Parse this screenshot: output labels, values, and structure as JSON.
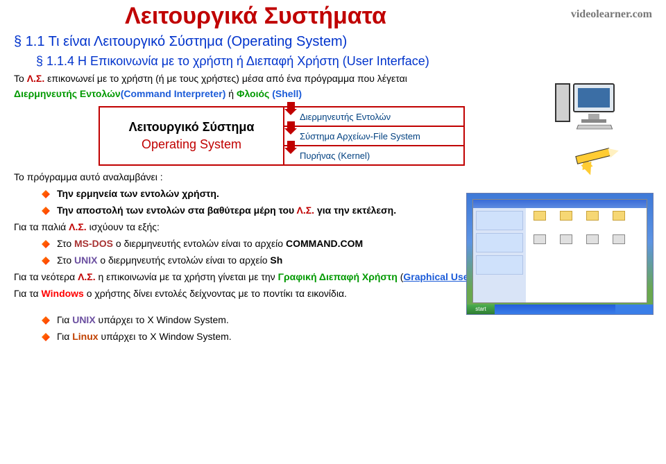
{
  "watermark": "videolearner.com",
  "title": "Λειτουργικά Συστήματα",
  "section": "1.1 Τι είναι Λειτουργικό Σύστημα (Operating System)",
  "subsection": "1.1.4 Η Επικοινωνία με το χρήστη ή Διεπαφή Χρήστη (User Interface)",
  "intro": {
    "pre": "Το ",
    "ls": "Λ.Σ.",
    "mid": " επικονωνεί με το χρήστη (ή με τους χρήστες) μέσα από ένα πρόγραμμα που λέγεται",
    "term1": "Διερμηνευτής Εντολών",
    "term1b": "(Command Interpreter)",
    "or": " ή ",
    "term2": "Φλοιός",
    "term2b": "(Shell)"
  },
  "osbox": {
    "line1": "Λειτουργικό Σύστημα",
    "line2": "Operating System",
    "cells": {
      "interp": "Διερμηνευτής Εντολών",
      "fs": "Σύστημα Αρχείων-File System",
      "kernel": "Πυρήνας (Kernel)"
    }
  },
  "program_receives": "Το πρόγραμμα αυτό αναλαμβάνει :",
  "bullets1": {
    "b1": "Την ερμηνεία των εντολών χρήστη.",
    "b2_pre": "Την αποστολή των εντολών στα ",
    "b2_bold": "βαθύτερα",
    "b2_mid": " μέρη του ",
    "b2_ls": "Λ.Σ.",
    "b2_post": " για την εκτέλεση."
  },
  "old_os": {
    "pre": "Για τα παλιά ",
    "ls": "Λ.Σ.",
    "post": " ισχύουν τα εξής:",
    "b1_pre": "Στο ",
    "b1_os": "MS-DOS",
    "b1_mid": " ο διερμηνευτής εντολών είναι το αρχείο ",
    "b1_file": "COMMAND.COM",
    "b2_pre": "Στο ",
    "b2_os": "UNIX",
    "b2_mid": " ο διερμηνευτής εντολών είναι το αρχείο ",
    "b2_file": "Sh"
  },
  "new_os": {
    "pre": "Για τα νεότερα  ",
    "ls": "Λ.Σ.",
    "mid": "  η επικοινωνία με τα χρήστη γίνεται με την ",
    "gui1": "Γραφική Διεπαφή Χρήστη",
    "open": " (",
    "gui2": "Graphical User Interface-GUI",
    "close": "):"
  },
  "windows": {
    "pre": "Για τα ",
    "os": "Windows",
    "post": " ο χρήστης δίνει εντολές δείχνοντας με το ποντίκι τα εικονίδια."
  },
  "tail": {
    "b1_pre": "Για ",
    "b1_os": "UNIX",
    "b1_post": " υπάρχει το X Window System.",
    "b2_pre": "Για ",
    "b2_os": "Linux ",
    "b2_post": " υπάρχει το X Window System."
  },
  "thumb": {
    "start": "start"
  }
}
